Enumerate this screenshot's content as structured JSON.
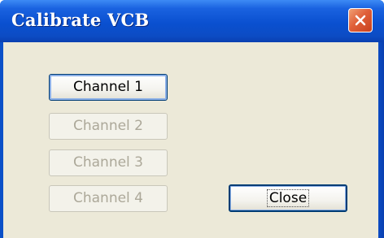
{
  "window": {
    "title": "Calibrate VCB"
  },
  "buttons": {
    "channel1": "Channel 1",
    "channel2": "Channel 2",
    "channel3": "Channel 3",
    "channel4": "Channel 4",
    "close": "Close"
  },
  "colors": {
    "titlebar": "#0a50d0",
    "client_background": "#ece9d8",
    "close_button": "#e0603a"
  }
}
